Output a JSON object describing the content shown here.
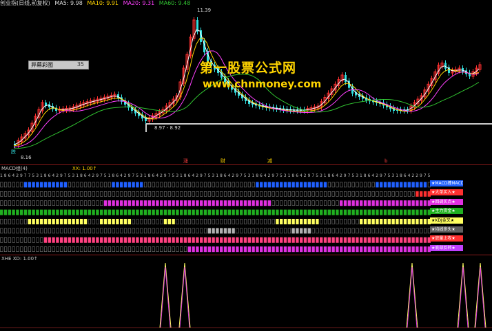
{
  "header": {
    "title": "创业指(日线,前复权)",
    "ma5": "MA5: 9.98",
    "ma10": "MA10: 9.91",
    "ma20": "MA20: 9.31",
    "ma60": "MA60: 9.48"
  },
  "price_labels": {
    "high": "11.39",
    "low": "8.16",
    "range": "8.97 - 8.92"
  },
  "side_box": {
    "label": "异幕彩图",
    "value": "35"
  },
  "watermark": {
    "line1": "第一股票公式网",
    "line2": "www.chnmoney.com"
  },
  "markers": {
    "m1": "跌",
    "m2": "涨",
    "m3": "财",
    "m4": "减",
    "m5": "b"
  },
  "macd_panel": {
    "header": "MACD组(4)",
    "mid": "XX: 1.00↑"
  },
  "strip_tags": [
    "★MACD缠MACD★",
    "★大单买入★",
    "★回调买点★",
    "★主力资金★",
    "★KDJ金叉★",
    "★均线多头★",
    "★放量上攻★",
    "★底部反转★"
  ],
  "xhe_panel": {
    "header": "XHE XD: 1.00↑"
  },
  "colors": {
    "up": "#ff3030",
    "down": "#30e0e0",
    "ma5": "#ffffff",
    "ma10": "#ffd400",
    "ma20": "#ff40ff",
    "ma60": "#30c030",
    "strip_blue": "#2060ff",
    "strip_red": "#ff3030",
    "strip_magenta": "#e030e0",
    "strip_green": "#20b020",
    "strip_yellow": "#ffff60",
    "strip_gray": "#b0b0b0",
    "strip_pink": "#ff4080",
    "strip_purple": "#c040ff"
  }
}
